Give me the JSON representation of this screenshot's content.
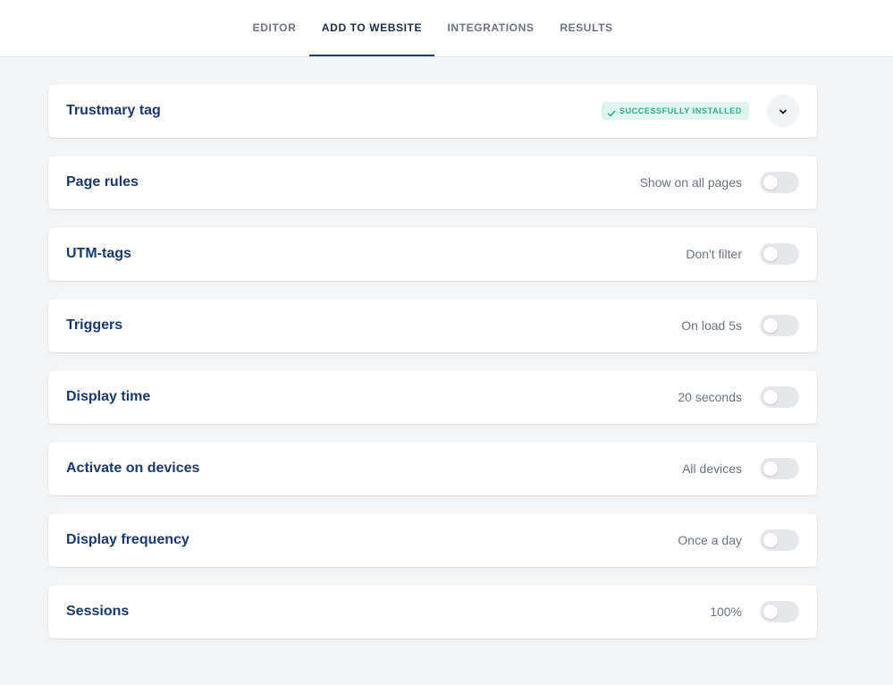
{
  "tabs": [
    {
      "label": "EDITOR",
      "active": false
    },
    {
      "label": "ADD TO WEBSITE",
      "active": true
    },
    {
      "label": "INTEGRATIONS",
      "active": false
    },
    {
      "label": "RESULTS",
      "active": false
    }
  ],
  "tag_card": {
    "title": "Trustmary tag",
    "status": "SUCCESSFULLY INSTALLED",
    "status_icon": "check-icon",
    "expand_icon": "chevron-down-icon"
  },
  "settings": [
    {
      "title": "Page rules",
      "value": "Show on all pages",
      "enabled": false
    },
    {
      "title": "UTM-tags",
      "value": "Don't filter",
      "enabled": false
    },
    {
      "title": "Triggers",
      "value": "On load 5s",
      "enabled": false
    },
    {
      "title": "Display time",
      "value": "20 seconds",
      "enabled": false
    },
    {
      "title": "Activate on devices",
      "value": "All devices",
      "enabled": false
    },
    {
      "title": "Display frequency",
      "value": "Once a day",
      "enabled": false
    },
    {
      "title": "Sessions",
      "value": "100%",
      "enabled": false
    }
  ],
  "colors": {
    "accent": "#1e3a6e",
    "title": "#1a3a6b",
    "success_bg": "#ddf5ee",
    "success_text": "#2fae8a",
    "page_bg": "#f3f4f6"
  }
}
